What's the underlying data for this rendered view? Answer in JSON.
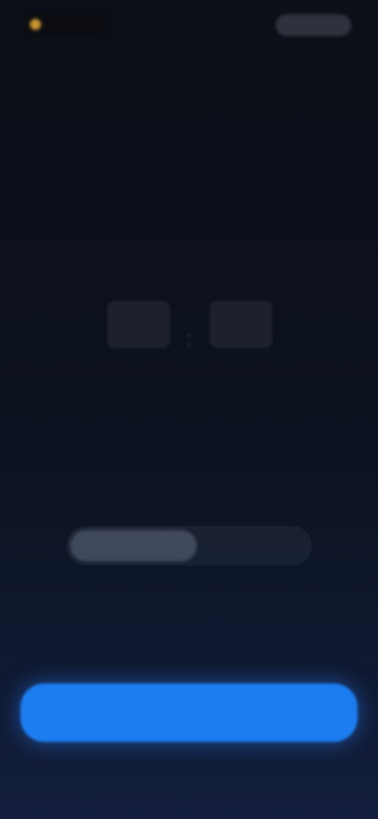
{
  "header": {
    "brand_text": "",
    "action_label": ""
  },
  "time_picker": {
    "hours": [
      "",
      "",
      ""
    ],
    "separator": ":",
    "minutes": [
      "",
      "",
      ""
    ]
  },
  "mode_toggle": {
    "options": [
      "",
      ""
    ]
  },
  "hint": {
    "line1": "",
    "line2": ""
  },
  "primary_button": {
    "label": ""
  },
  "footer": {
    "link_label": ""
  },
  "colors": {
    "accent": "#1b7df0",
    "brand": "#c8952e",
    "background": "#0d1220"
  }
}
